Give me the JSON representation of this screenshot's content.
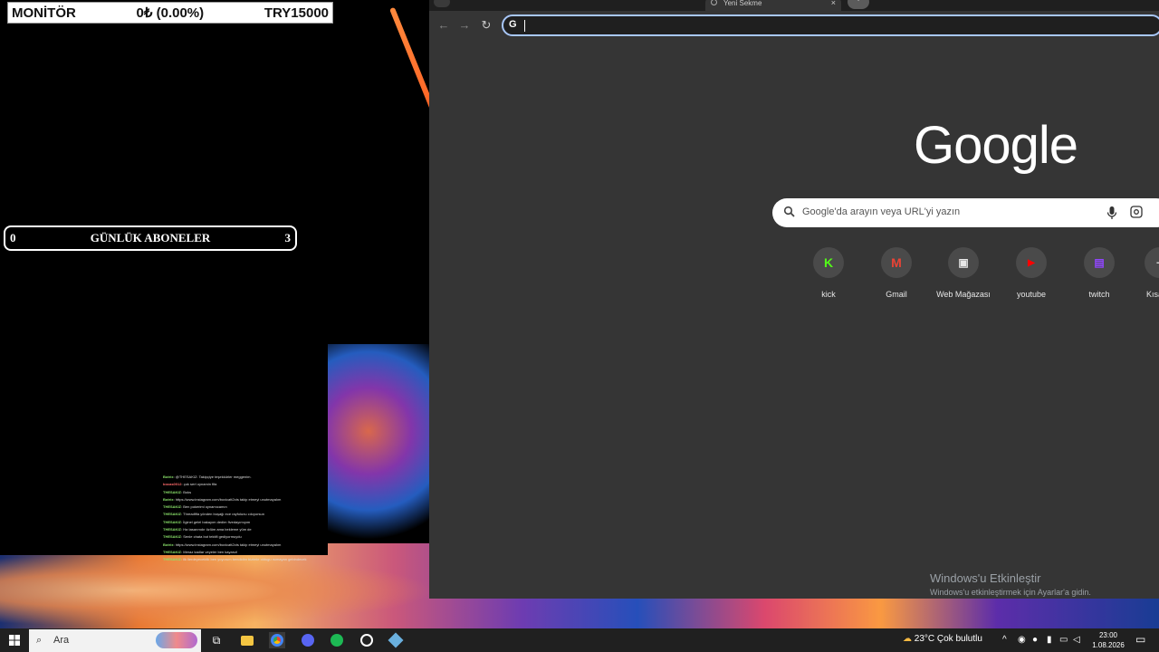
{
  "ticker": {
    "name": "MONİTÖR",
    "value": "0₺ (0.00%)",
    "target": "TRY15000"
  },
  "subscribers": {
    "left": "0",
    "title": "GÜNLÜK ABONELER",
    "right": "3"
  },
  "chat": [
    {
      "user": "Botrix",
      "text": "@THESAKIZ: Takipçiye teşekkürler meggenim."
    },
    {
      "user": "bocas0012",
      "text": "çok sert oynamin fifa"
    },
    {
      "user": "THESAKIZ",
      "text": "Boks"
    },
    {
      "user": "Botrix",
      "text": "https://www.instagram.com/boxicatt2cts takip etmeyi unutmayalım"
    },
    {
      "user": "THESAKIZ",
      "text": "Ben pokerimi oynamıcamın"
    },
    {
      "user": "THESAKIZ",
      "text": "Threadfifa yönden boşağı ece rayfolunu cıkıyorsun"
    },
    {
      "user": "THESAKIZ",
      "text": "İlginel gelel bakayım dedim fivedayımıyım"
    },
    {
      "user": "THESAKIZ",
      "text": "Ha tasarımdır özlüm ama bekleme yüm de"
    },
    {
      "user": "THESAKIZ",
      "text": "Senle chata bot tektifi gediyormuydu"
    },
    {
      "user": "Botrix",
      "text": "https://www.instagram.com/boxicatt2cts takip etmeyi unutmayalım"
    },
    {
      "user": "THESAKIZ",
      "text": "Meraz kadlar veyeler ben kayarızl"
    },
    {
      "user": "THESAKIZ",
      "text": "ilk ilerdeyecektik ben yoyorum bendidim bizimle oldugu ısımayan gebindecek"
    }
  ],
  "browser": {
    "tab_title": "Yeni Sekme",
    "tab_close": "×",
    "new_tab": "+",
    "back": "←",
    "forward": "→",
    "reload": "↻",
    "omnibox_icon": "G",
    "logo": "Google",
    "search_placeholder": "Google'da arayın veya URL'yi yazın",
    "shortcuts": [
      {
        "label": "kick",
        "glyph": "K",
        "color": "#53fc18",
        "icon": "kick-icon"
      },
      {
        "label": "Gmail",
        "glyph": "M",
        "color": "#ea4335",
        "icon": "gmail-icon"
      },
      {
        "label": "Web Mağazası",
        "glyph": "▣",
        "color": "#e8e8e8",
        "icon": "web-store-icon"
      },
      {
        "label": "youtube",
        "glyph": "▶",
        "color": "#ff0000",
        "icon": "youtube-icon"
      },
      {
        "label": "twitch",
        "glyph": "▤",
        "color": "#9146ff",
        "icon": "twitch-icon"
      },
      {
        "label": "Kısa",
        "glyph": "+",
        "color": "#cccccc",
        "icon": "add-shortcut-icon"
      }
    ]
  },
  "activation": {
    "title": "Windows'u Etkinleştir",
    "subtitle": "Windows'u etkinleştirmek için Ayarlar'a gidin."
  },
  "taskbar": {
    "search_label": "Ara",
    "weather": "23°C  Çok bulutlu",
    "time": "23:00",
    "date": "1.08.2026"
  }
}
